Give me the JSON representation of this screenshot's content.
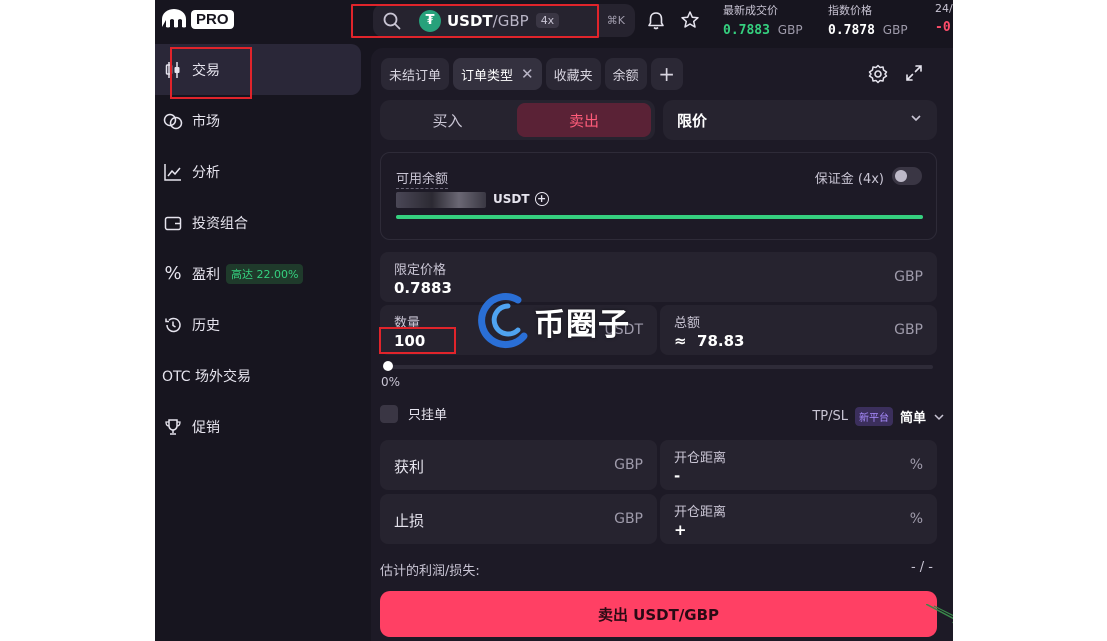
{
  "header": {
    "pro_badge": "PRO",
    "pair_base": "USDT",
    "pair_quote": "/GBP",
    "leverage": "4x",
    "shortcut": "⌘K",
    "last_price_label": "最新成交价",
    "last_price_value": "0.7883",
    "last_price_currency": "GBP",
    "index_price_label": "指数价格",
    "index_price_value": "0.7878",
    "index_price_currency": "GBP",
    "change_label": "24/",
    "change_value": "-0"
  },
  "sidebar": {
    "items": [
      {
        "label": "交易",
        "icon": "candlestick-icon"
      },
      {
        "label": "市场",
        "icon": "coins-icon"
      },
      {
        "label": "分析",
        "icon": "chart-line-icon"
      },
      {
        "label": "投资组合",
        "icon": "wallet-icon"
      },
      {
        "label": "盈利",
        "icon": "percent-icon",
        "badge": "高达 22.00%"
      },
      {
        "label": "历史",
        "icon": "history-icon"
      },
      {
        "label": "OTC 场外交易",
        "icon": "otc-icon"
      },
      {
        "label": "促销",
        "icon": "trophy-icon"
      }
    ]
  },
  "panel": {
    "tabs": [
      "未结订单",
      "订单类型",
      "收藏夹",
      "余额"
    ],
    "buy_label": "买入",
    "sell_label": "卖出",
    "order_type": "限价",
    "available_label": "可用余额",
    "available_currency": "USDT",
    "available_fill_fraction": 1.0,
    "margin_label": "保证金 (4x)",
    "limit_price_label": "限定价格",
    "limit_price_value": "0.7883",
    "limit_price_currency": "GBP",
    "quantity_label": "数量",
    "quantity_value": "100",
    "quantity_currency": "USDT",
    "total_label": "总额",
    "total_value": "≈  78.83",
    "total_currency": "GBP",
    "slider_percent": "0%",
    "post_only_label": "只挂单",
    "tpsl_label": "TP/SL",
    "new_platform_badge": "新平台",
    "simple_label": "简单",
    "take_profit_label": "获利",
    "take_profit_currency": "GBP",
    "tp_distance_label": "开仓距离",
    "tp_distance_value": "-",
    "tp_distance_unit": "%",
    "stop_loss_label": "止损",
    "stop_loss_currency": "GBP",
    "sl_distance_label": "开仓距离",
    "sl_distance_value": "+",
    "sl_distance_unit": "%",
    "estimate_label": "估计的利润/损失:",
    "estimate_value": "- / -",
    "submit_label": "卖出 USDT/GBP"
  },
  "watermark": {
    "text": "币圈子"
  },
  "colors": {
    "accent_red": "#ff4064",
    "green": "#35d07f",
    "highlight_box": "#e0242b",
    "arrow": "#3a8a4a"
  }
}
